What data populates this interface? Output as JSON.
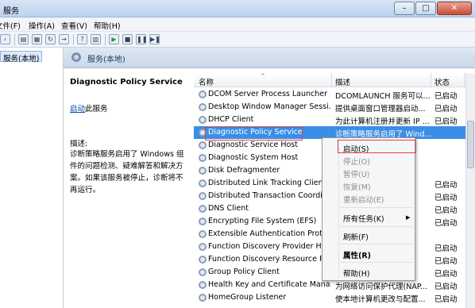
{
  "window": {
    "title": "服务",
    "btn_min": "–",
    "btn_max": "□",
    "btn_close": "✕"
  },
  "menubar": [
    "文件(F)",
    "操作(A)",
    "查看(V)",
    "帮助(H)"
  ],
  "tree": {
    "item": "服务(本地)"
  },
  "pane": {
    "title": "服务(本地)"
  },
  "desc": {
    "service_name": "Diagnostic Policy Service",
    "start_link": "启动",
    "start_suffix": "此服务",
    "label": "描述:",
    "text": "诊断策略服务启用了 Windows 组件的问题检测、疑难解答和解决方案。如果该服务被停止，诊断将不再运行。"
  },
  "columns": {
    "name": "名称",
    "desc": "描述",
    "status": "状态"
  },
  "rows": [
    {
      "name": "DCOM Server Process Launcher",
      "desc": "DCOMLAUNCH 服务可以...",
      "status": "已启动"
    },
    {
      "name": "Desktop Window Manager Sessi...",
      "desc": "提供桌面窗口管理器启动...",
      "status": "已启动"
    },
    {
      "name": "DHCP Client",
      "desc": "为此计算机注册并更新 IP ...",
      "status": "已启动"
    },
    {
      "name": "Diagnostic Policy Service",
      "desc": "诊断策略服务启用了 Wind...",
      "status": ""
    },
    {
      "name": "Diagnostic Service Host",
      "desc": "",
      "status": ""
    },
    {
      "name": "Diagnostic System Host",
      "desc": "",
      "status": ""
    },
    {
      "name": "Disk Defragmenter",
      "desc": "",
      "status": ""
    },
    {
      "name": "Distributed Link Tracking Client",
      "desc": "",
      "status": "已启动"
    },
    {
      "name": "Distributed Transaction Coordin...",
      "desc": "",
      "status": "已启动"
    },
    {
      "name": "DNS Client",
      "desc": "",
      "status": "已启动"
    },
    {
      "name": "Encrypting File System (EFS)",
      "desc": "",
      "status": "已启动"
    },
    {
      "name": "Extensible Authentication Protoco...",
      "desc": "",
      "status": ""
    },
    {
      "name": "Function Discovery Provider Host",
      "desc": "",
      "status": "已启动"
    },
    {
      "name": "Function Discovery Resource Pub...",
      "desc": "",
      "status": "已启动"
    },
    {
      "name": "Group Policy Client",
      "desc": "",
      "status": "已启动"
    },
    {
      "name": "Health Key and Certificate Mana...",
      "desc": "为网络访问保护代理(NAP...",
      "status": "已启动"
    },
    {
      "name": "HomeGroup Listener",
      "desc": "使本地计算机更改与配置...",
      "status": "已启动"
    }
  ],
  "context_menu": {
    "start": "启动(S)",
    "stop": "停止(O)",
    "pause": "暂停(U)",
    "resume": "恢复(M)",
    "restart": "重新启动(E)",
    "all_tasks": "所有任务(K)",
    "refresh": "刷新(F)",
    "properties": "属性(R)",
    "help": "帮助(H)"
  }
}
